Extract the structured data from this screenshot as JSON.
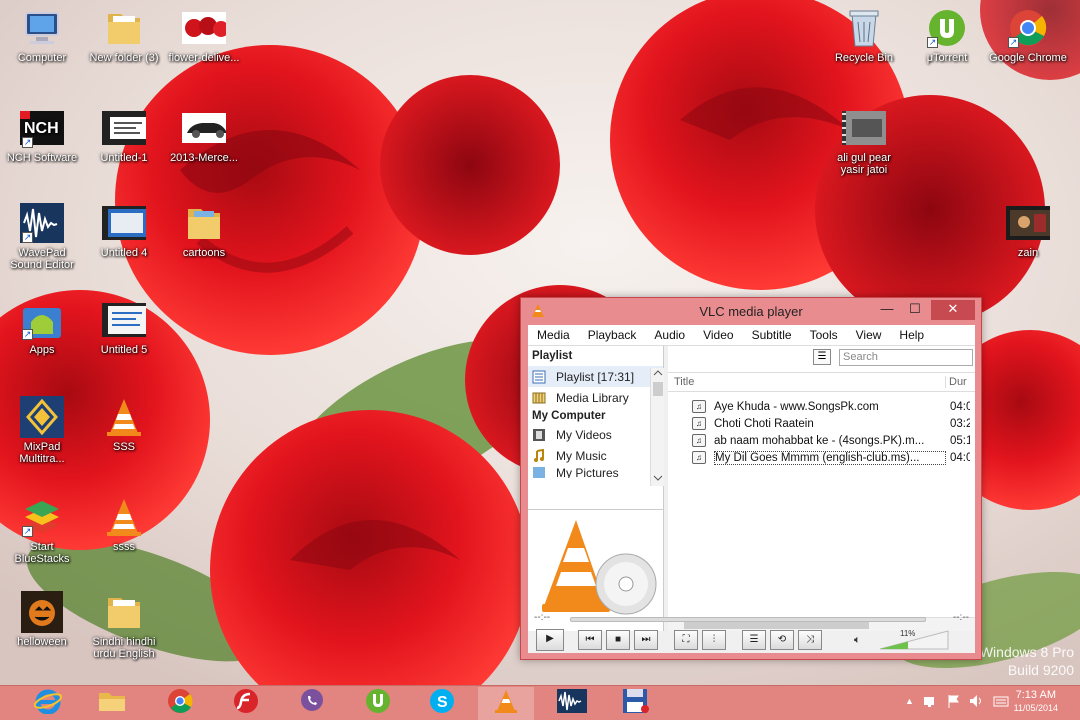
{
  "desktop": {
    "icons": [
      {
        "id": "computer",
        "label": "Computer"
      },
      {
        "id": "newfolder",
        "label": "New folder (3)"
      },
      {
        "id": "flower",
        "label": "flower-delive..."
      },
      {
        "id": "recycle",
        "label": "Recycle Bin"
      },
      {
        "id": "utorrent",
        "label": "μTorrent"
      },
      {
        "id": "chrome",
        "label": "Google Chrome"
      },
      {
        "id": "nch",
        "label": "NCH Software"
      },
      {
        "id": "untitled1",
        "label": "Untitled-1"
      },
      {
        "id": "merc",
        "label": "2013-Merce..."
      },
      {
        "id": "aligul",
        "label": "ali gul pear yasir jatoi"
      },
      {
        "id": "wavepad",
        "label": "WavePad Sound Editor"
      },
      {
        "id": "untitled4",
        "label": "Untitled 4"
      },
      {
        "id": "cartoons",
        "label": "cartoons"
      },
      {
        "id": "zain",
        "label": "zain"
      },
      {
        "id": "apps",
        "label": "Apps"
      },
      {
        "id": "untitled5",
        "label": "Untitled 5"
      },
      {
        "id": "mixpad",
        "label": "MixPad Multitra..."
      },
      {
        "id": "sss",
        "label": "SSS"
      },
      {
        "id": "bluestacks",
        "label": "Start BlueStacks"
      },
      {
        "id": "ssss",
        "label": "ssss"
      },
      {
        "id": "helloween",
        "label": "helloween"
      },
      {
        "id": "sindhi",
        "label": "Sindhi hindhi urdu English"
      }
    ],
    "watermark_line1": "Windows 8 Pro",
    "watermark_line2": "Build 9200"
  },
  "vlc": {
    "title": "VLC media player",
    "minimize": "—",
    "maximize": "☐",
    "close": "✕",
    "menu": [
      "Media",
      "Playback",
      "Audio",
      "Video",
      "Subtitle",
      "Tools",
      "View",
      "Help"
    ],
    "sidebar": {
      "header": "Playlist",
      "playlist_item": "Playlist [17:31]",
      "media_library": "Media Library",
      "group_computer": "My Computer",
      "my_videos": "My Videos",
      "my_music": "My Music",
      "my_pictures": "My Pictures"
    },
    "search_placeholder": "Search",
    "columns": {
      "title": "Title",
      "duration": "Dur"
    },
    "tracks": [
      {
        "title": "Aye Khuda - www.SongsPk.com",
        "duration": "04:0"
      },
      {
        "title": "Choti Choti Raatein",
        "duration": "03:2"
      },
      {
        "title": "ab naam mohabbat ke - (4songs.PK).m...",
        "duration": "05:1"
      },
      {
        "title": "My Dil Goes Mmmm (english-club.ms)...",
        "duration": "04:0"
      }
    ],
    "time_elapsed": "--:--",
    "time_total": "--:--",
    "volume": "11%"
  },
  "taskbar": {
    "clock_time": "7:13 AM",
    "clock_date": "11/05/2014"
  },
  "colors": {
    "taskbar": "#e2847f",
    "vlc_frame": "#e88c90",
    "vlc_orange": "#f28a1b"
  }
}
